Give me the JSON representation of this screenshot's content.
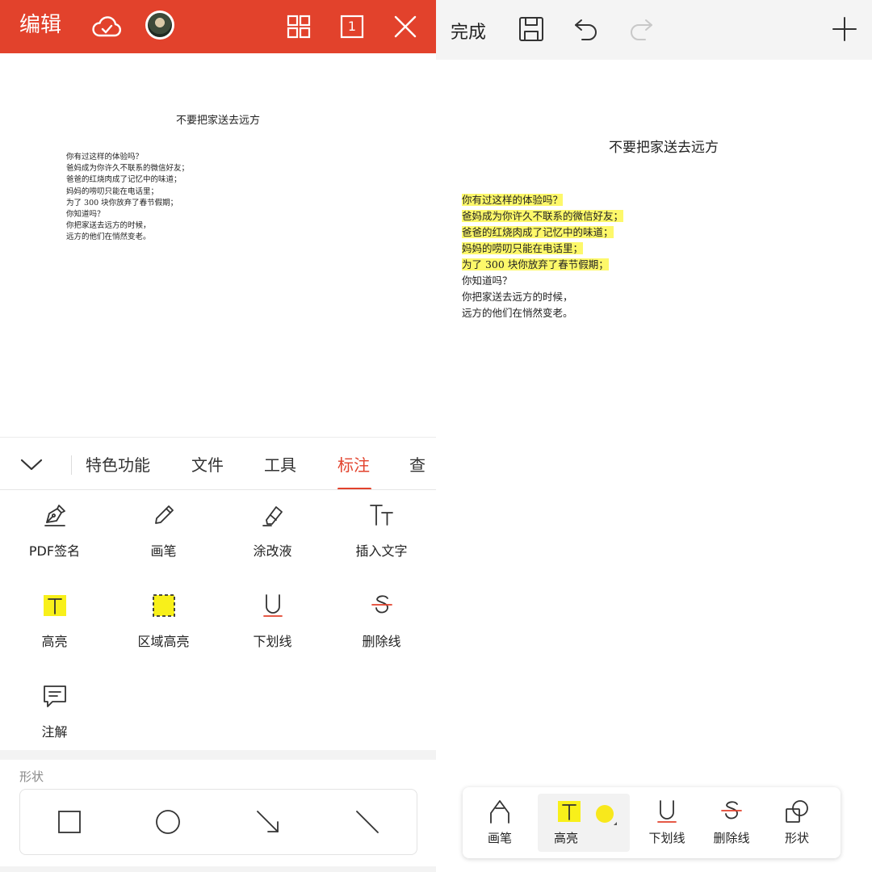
{
  "left": {
    "header": {
      "title": "编辑",
      "bg_color": "#e2422c",
      "icons": [
        "cloud-check-icon",
        "avatar",
        "grid-icon",
        "page-count-icon",
        "close-icon"
      ],
      "page_count": "1"
    },
    "document": {
      "title": "不要把家送去远方",
      "lines": [
        "你有过这样的体验吗？",
        "爸妈成为你许久不联系的微信好友；",
        "爸爸的红烧肉成了记忆中的味道；",
        "妈妈的唠叨只能在电话里；",
        "为了 300 块你放弃了春节假期；",
        "你知道吗？",
        "你把家送去远方的时候，",
        "远方的他们在悄然变老。"
      ]
    },
    "tabs": {
      "items": [
        {
          "label": "特色功能"
        },
        {
          "label": "文件"
        },
        {
          "label": "工具"
        },
        {
          "label": "标注"
        },
        {
          "label": "查"
        }
      ],
      "active": "标注",
      "accent_color": "#e2422c"
    },
    "tools": [
      {
        "label": "PDF签名",
        "icon": "pen-nib-icon"
      },
      {
        "label": "画笔",
        "icon": "pencil-icon"
      },
      {
        "label": "涂改液",
        "icon": "eraser-icon"
      },
      {
        "label": "插入文字",
        "icon": "text-size-icon"
      },
      {
        "label": "高亮",
        "icon": "highlight-icon"
      },
      {
        "label": "区域高亮",
        "icon": "area-highlight-icon"
      },
      {
        "label": "下划线",
        "icon": "underline-icon"
      },
      {
        "label": "删除线",
        "icon": "strikethrough-icon"
      },
      {
        "label": "注解",
        "icon": "comment-icon"
      }
    ],
    "shapes": {
      "title": "形状",
      "items": [
        "rectangle-icon",
        "circle-icon",
        "arrow-icon",
        "line-icon"
      ]
    }
  },
  "right": {
    "header": {
      "done_label": "完成",
      "icons": [
        "save-icon",
        "undo-icon",
        "redo-icon",
        "add-icon"
      ]
    },
    "document": {
      "title": "不要把家送去远方",
      "highlight_color": "#fdf86a",
      "lines": [
        {
          "text": "你有过这样的体验吗？",
          "highlighted": true
        },
        {
          "text": "爸妈成为你许久不联系的微信好友；",
          "highlighted": true
        },
        {
          "text": "爸爸的红烧肉成了记忆中的味道；",
          "highlighted": true
        },
        {
          "text": "妈妈的唠叨只能在电话里；",
          "highlighted": true
        },
        {
          "text": "为了 300 块你放弃了春节假期；",
          "highlighted": true
        },
        {
          "text": "你知道吗？",
          "highlighted": false
        },
        {
          "text": "你把家送去远方的时候，",
          "highlighted": false
        },
        {
          "text": "远方的他们在悄然变老。",
          "highlighted": false
        }
      ]
    },
    "toolbar": [
      {
        "label": "画笔",
        "icon": "pen-icon"
      },
      {
        "label": "高亮",
        "icon": "highlight-icon",
        "active": true,
        "color_dot": "#f8e81c"
      },
      {
        "label": "下划线",
        "icon": "underline-icon"
      },
      {
        "label": "删除线",
        "icon": "strikethrough-icon"
      },
      {
        "label": "形状",
        "icon": "shapes-icon"
      }
    ]
  }
}
